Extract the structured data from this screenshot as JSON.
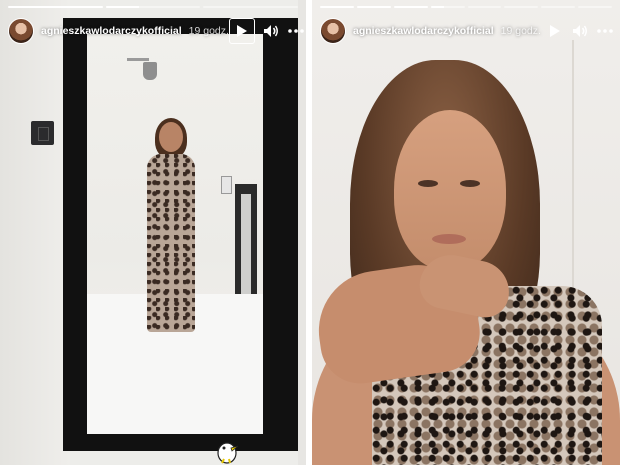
{
  "stories": [
    {
      "username": "agnieszkawlodarczykofficial",
      "time_ago": "19 godz.",
      "progress": [
        1,
        0.35,
        0
      ],
      "controls": {
        "play": "play-icon",
        "sound": "speaker-icon",
        "more": "more-icon"
      }
    },
    {
      "username": "agnieszkawlodarczykofficial",
      "time_ago": "19 godz.",
      "progress": [
        1,
        1,
        1,
        0.4,
        0,
        0,
        0,
        0
      ],
      "controls": {
        "play": "play-icon",
        "sound": "speaker-icon",
        "more": "more-icon"
      }
    }
  ],
  "colors": {
    "text": "#ffffff",
    "progress_track": "rgba(255,255,255,0.45)"
  }
}
